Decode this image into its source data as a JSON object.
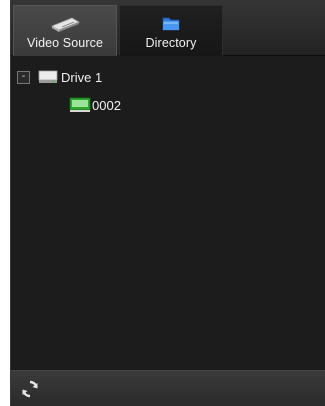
{
  "tabs": [
    {
      "label": "Video Source",
      "icon": "hard-drive-icon",
      "active": true
    },
    {
      "label": "Directory",
      "icon": "folder-icon",
      "active": false
    }
  ],
  "tree": {
    "drive": {
      "expander": "-",
      "label": "Drive 1",
      "icon": "drive-icon"
    },
    "camera": {
      "label": "0002",
      "icon": "camera-channel-icon"
    }
  },
  "footer": {
    "refresh_icon": "refresh-icon"
  },
  "colors": {
    "panel_bg": "#1b1b1b",
    "tab_active": "#404040",
    "text": "#f0f0f0"
  }
}
